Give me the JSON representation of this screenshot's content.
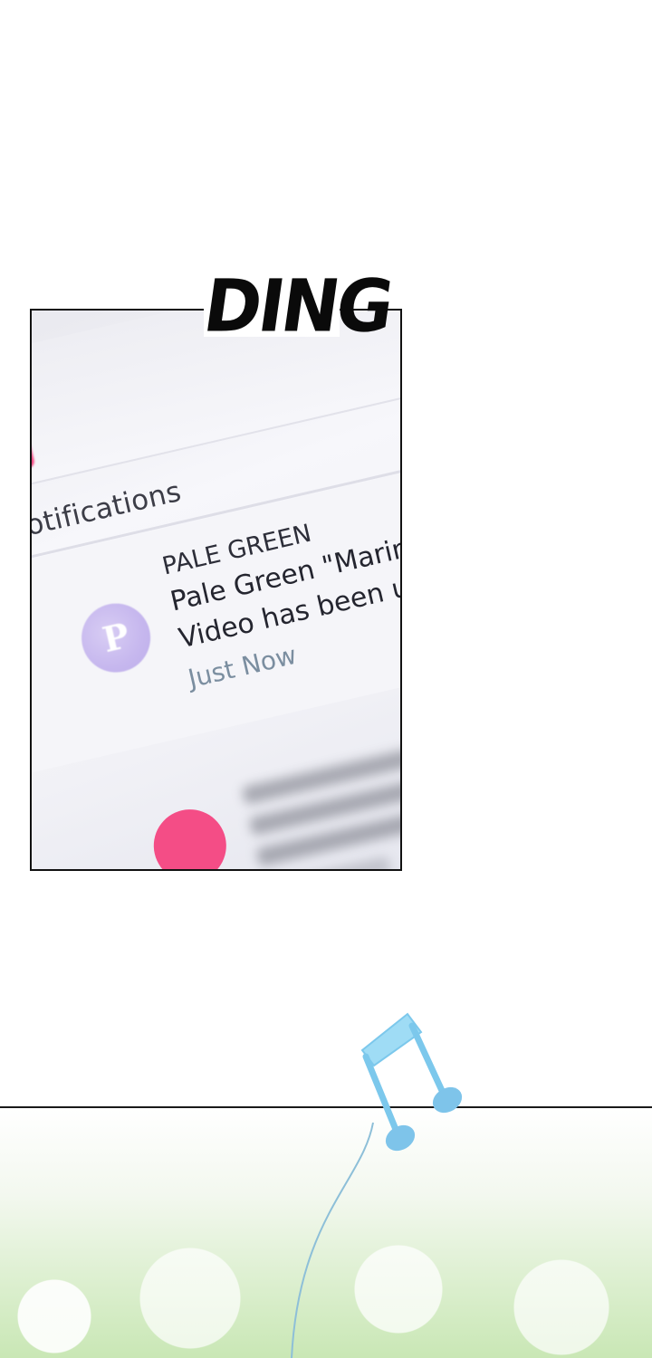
{
  "sfx": {
    "ding": "DING"
  },
  "phone": {
    "header": "Notifications",
    "notification": {
      "sender": "PALE GREEN",
      "line1": "Pale Green \"Marine",
      "line2": "Video has been up",
      "time": "Just Now",
      "avatar_letter": "P"
    }
  },
  "colors": {
    "accent_pink": "#f24680",
    "avatar_purple": "#c6b7ee",
    "time_gray_blue": "#7b8ea0",
    "note_blue": "#7cc8ec",
    "grass_green": "#c9e7b5"
  },
  "icons": {
    "music_note": "music-note-icon"
  }
}
